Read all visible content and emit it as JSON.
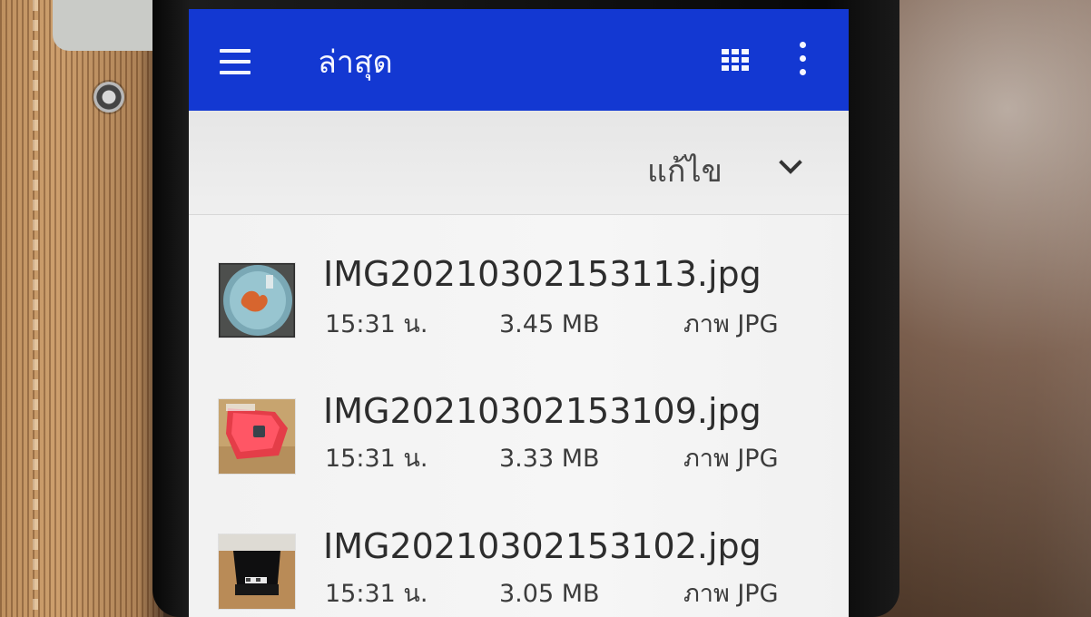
{
  "header": {
    "menu_icon": "hamburger-menu-icon",
    "title": "ล่าสุด",
    "view_icon": "grid-view-icon",
    "more_icon": "more-vertical-icon",
    "color": "#1338d2"
  },
  "sort": {
    "label": "แก้ไข",
    "icon": "chevron-down-icon"
  },
  "files": [
    {
      "name": "IMG20210302153113.jpg",
      "time": "15:31 น.",
      "size": "3.45 MB",
      "type": "ภาพ JPG",
      "thumbnail": "image-thumbnail-round-object"
    },
    {
      "name": "IMG20210302153109.jpg",
      "time": "15:31 น.",
      "size": "3.33 MB",
      "type": "ภาพ JPG",
      "thumbnail": "image-thumbnail-red-object"
    },
    {
      "name": "IMG20210302153102.jpg",
      "time": "15:31 น.",
      "size": "3.05 MB",
      "type": "ภาพ JPG",
      "thumbnail": "image-thumbnail-black-device"
    }
  ]
}
